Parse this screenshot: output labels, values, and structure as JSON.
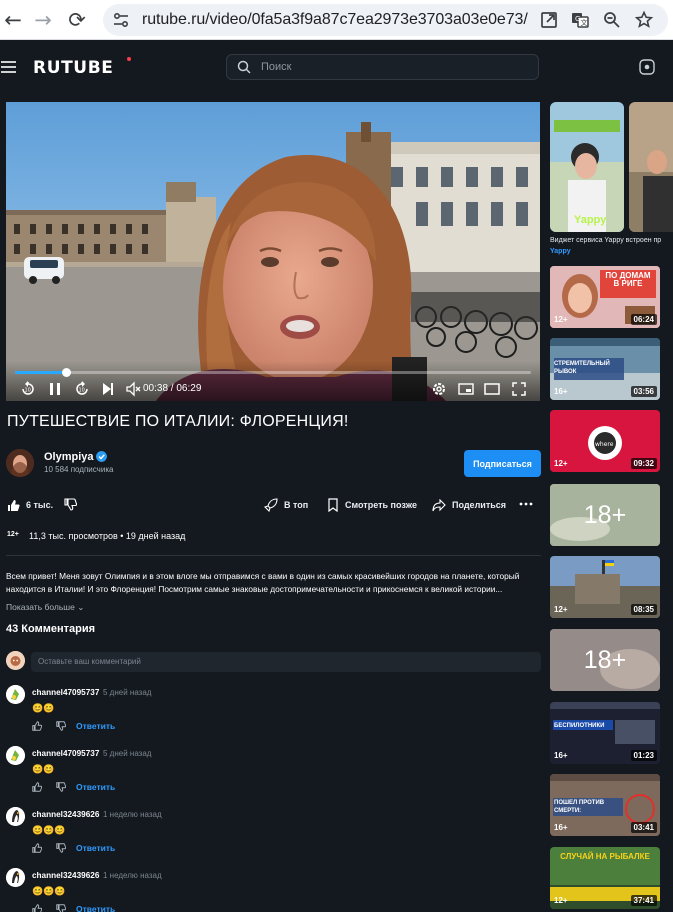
{
  "browser": {
    "url": "rutube.ru/video/0fa5a3f9a87c7ea2973e3703a03e0e73/"
  },
  "header": {
    "logo": "RUTUBE",
    "search_placeholder": "Поиск"
  },
  "player": {
    "time": "00:38 / 06:29",
    "progress": 0.098
  },
  "video": {
    "title": "ПУТЕШЕСТВИЕ ПО ИТАЛИИ: ФЛОРЕНЦИЯ!",
    "channel": "Olympiya",
    "subscribers": "10 584 подписчика",
    "subscribe_label": "Подписаться",
    "likes": "6 тыс.",
    "actions": {
      "top": "В топ",
      "later": "Смотреть позже",
      "share": "Поделиться"
    },
    "age": "12+",
    "stats": "11,3 тыс. просмотров • 19 дней назад",
    "description": "Всем привет! Меня зовут Олимпия и в этом влоге мы отправимся с вами в один из самых красивейших городов на планете, который находится в Италии! И это Флоренция! Посмотрим самые знаковые достопримечательности и прикоснемся к великой истории...",
    "show_more": "Показать больше"
  },
  "comments": {
    "count_label": "43 Комментария",
    "input_placeholder": "Оставьте ваш комментарий",
    "reply_label": "Ответить",
    "items": [
      {
        "author": "channel47095737",
        "time": "5 дней назад",
        "text": "😊😊"
      },
      {
        "author": "channel47095737",
        "time": "5 дней назад",
        "text": "😊😊"
      },
      {
        "author": "channel32439626",
        "time": "1 неделю назад",
        "text": "😊😊😊"
      },
      {
        "author": "channel32439626",
        "time": "1 неделю назад",
        "text": "😊😊😊"
      }
    ]
  },
  "sidebar": {
    "yappy_caption": "Виджет сервиса Yappy встроен пр",
    "yappy_brand": "Yappy",
    "yappy_logo": "Yappy",
    "videos": [
      {
        "age": "12+",
        "duration": "06:24",
        "thumb_text": "ПО ДОМАМ В РИГЕ"
      },
      {
        "age": "16+",
        "duration": "03:56",
        "thumb_text": "СТРЕМИТЕЛЬНЫЙ РЫВОК"
      },
      {
        "age": "12+",
        "duration": "09:32",
        "thumb_text": ""
      },
      {
        "age": "",
        "duration": "",
        "thumb_text": "18+"
      },
      {
        "age": "12+",
        "duration": "08:35",
        "thumb_text": ""
      },
      {
        "age": "",
        "duration": "",
        "thumb_text": "18+"
      },
      {
        "age": "16+",
        "duration": "01:23",
        "thumb_text": "БЕСПИЛОТНИКИ"
      },
      {
        "age": "16+",
        "duration": "03:41",
        "thumb_text": "ПОШЕЛ ПРОТИВ СМЕРТИ:"
      },
      {
        "age": "12+",
        "duration": "37:41",
        "thumb_text": "СЛУЧАЙ НА РЫБАЛКЕ"
      }
    ]
  }
}
